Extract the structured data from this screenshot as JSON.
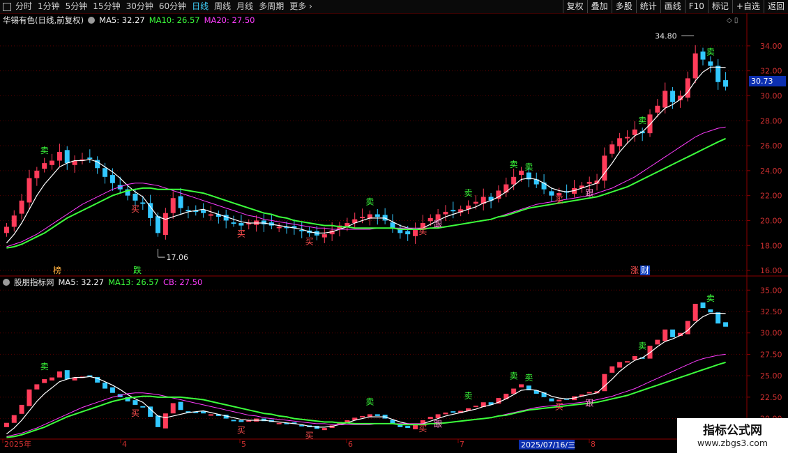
{
  "toolbar": {
    "periods": [
      "分时",
      "1分钟",
      "5分钟",
      "15分钟",
      "30分钟",
      "60分钟",
      "日线",
      "周线",
      "月线",
      "多周期",
      "更多"
    ],
    "active_period": "日线",
    "right_buttons": [
      "复权",
      "叠加",
      "多股",
      "统计",
      "画线",
      "F10",
      "标记",
      "+自选",
      "返回"
    ]
  },
  "main_legend": {
    "title": "华锡有色(日线,前复权)",
    "ma5": "MA5: 32.27",
    "ma10": "MA10: 26.57",
    "ma20": "MA20: 27.50"
  },
  "sub_legend": {
    "title": "股朋指标网",
    "ma5": "MA5: 32.27",
    "ma13": "MA13: 26.57",
    "cb": "CB: 27.50"
  },
  "main_axis_ticks": [
    "34.00",
    "32.00",
    "30.00",
    "28.00",
    "26.00",
    "24.00",
    "22.00",
    "20.00",
    "18.00",
    "16.00"
  ],
  "sub_axis_ticks": [
    "35.00",
    "32.50",
    "30.00",
    "27.50",
    "25.00",
    "22.50",
    "20.00"
  ],
  "current_price": "30.73",
  "high_annotation": "34.80",
  "low_annotation": "17.06",
  "x_labels": [
    "2025年",
    "4",
    "5",
    "6",
    "7",
    "8"
  ],
  "cursor_date": "2025/07/16/三",
  "badges": {
    "bang": "榜",
    "die": "跌",
    "zhang": "涨",
    "cai": "财"
  },
  "signals": {
    "sell": "卖",
    "buy": "买",
    "follow": "跟"
  },
  "watermark": {
    "line1": "指标公式网",
    "line2": "www.zbgs3.com"
  },
  "colors": {
    "up": "#ff3c5a",
    "down": "#32c8ff",
    "ma_white": "#ffffff",
    "ma_green": "#3cff3c",
    "ma_magenta": "#ff3cff",
    "grid": "#5a0000"
  },
  "chart_data": {
    "type": "candlestick",
    "closes": [
      19.5,
      20.4,
      21.6,
      23.4,
      24.0,
      24.6,
      24.8,
      25.5,
      24.6,
      24.8,
      24.9,
      25.0,
      24.2,
      23.5,
      23.0,
      22.5,
      22.0,
      21.6,
      21.4,
      20.2,
      19.0,
      20.6,
      21.8,
      21.0,
      20.8,
      20.7,
      20.6,
      20.5,
      20.3,
      20.0,
      19.8,
      19.6,
      19.8,
      20.0,
      19.7,
      19.6,
      19.5,
      19.4,
      19.4,
      19.2,
      19.0,
      18.8,
      18.9,
      19.2,
      19.6,
      19.8,
      20.1,
      20.3,
      20.5,
      20.3,
      20.0,
      19.4,
      19.0,
      18.9,
      19.3,
      19.8,
      20.2,
      20.5,
      20.7,
      20.8,
      20.9,
      21.2,
      21.5,
      21.9,
      21.6,
      22.4,
      22.9,
      23.5,
      24.0,
      23.3,
      22.9,
      22.5,
      22.0,
      22.2,
      22.3,
      22.6,
      22.8,
      23.1,
      23.2,
      25.2,
      26.1,
      26.6,
      26.7,
      27.3,
      27.0,
      28.5,
      29.2,
      30.4,
      29.5,
      30.0,
      31.4,
      33.4,
      32.9,
      32.4,
      31.1,
      30.73
    ],
    "ma_short": [
      18.2,
      18.9,
      19.8,
      20.9,
      22.0,
      22.9,
      23.6,
      24.3,
      24.6,
      24.8,
      24.8,
      24.9,
      24.7,
      24.3,
      23.9,
      23.4,
      22.8,
      22.3,
      21.9,
      21.1,
      20.3,
      20.1,
      20.3,
      20.5,
      20.7,
      20.8,
      20.9,
      20.7,
      20.5,
      20.3,
      20.1,
      19.9,
      19.8,
      19.8,
      19.8,
      19.7,
      19.6,
      19.5,
      19.4,
      19.3,
      19.1,
      19.0,
      19.0,
      19.1,
      19.3,
      19.5,
      19.8,
      20.0,
      20.2,
      20.2,
      20.2,
      19.9,
      19.6,
      19.4,
      19.3,
      19.4,
      19.7,
      20.0,
      20.3,
      20.5,
      20.7,
      20.9,
      21.1,
      21.4,
      21.6,
      21.9,
      22.3,
      22.8,
      23.3,
      23.4,
      23.3,
      23.0,
      22.6,
      22.4,
      22.3,
      22.4,
      22.6,
      22.8,
      23.0,
      23.8,
      24.6,
      25.5,
      26.2,
      26.8,
      27.1,
      27.7,
      28.4,
      29.0,
      29.3,
      29.7,
      30.3,
      31.2,
      31.9,
      32.3,
      32.3,
      32.27
    ],
    "ma_long": [
      17.8,
      17.9,
      18.1,
      18.4,
      18.7,
      19.0,
      19.4,
      19.8,
      20.2,
      20.5,
      20.8,
      21.1,
      21.4,
      21.7,
      22.0,
      22.2,
      22.4,
      22.5,
      22.6,
      22.6,
      22.5,
      22.5,
      22.5,
      22.5,
      22.4,
      22.3,
      22.2,
      22.0,
      21.8,
      21.6,
      21.4,
      21.2,
      21.0,
      20.8,
      20.6,
      20.5,
      20.3,
      20.2,
      20.0,
      19.9,
      19.8,
      19.7,
      19.6,
      19.6,
      19.5,
      19.5,
      19.4,
      19.4,
      19.4,
      19.4,
      19.4,
      19.4,
      19.3,
      19.3,
      19.3,
      19.3,
      19.4,
      19.4,
      19.5,
      19.6,
      19.7,
      19.8,
      19.9,
      20.0,
      20.1,
      20.3,
      20.4,
      20.6,
      20.8,
      21.0,
      21.1,
      21.2,
      21.3,
      21.4,
      21.5,
      21.6,
      21.7,
      21.8,
      21.9,
      22.1,
      22.3,
      22.5,
      22.7,
      23.0,
      23.3,
      23.6,
      23.9,
      24.2,
      24.5,
      24.8,
      25.1,
      25.4,
      25.7,
      26.0,
      26.3,
      26.57
    ],
    "ma_mid": [
      17.9,
      18.1,
      18.3,
      18.6,
      18.9,
      19.3,
      19.7,
      20.1,
      20.5,
      20.9,
      21.3,
      21.6,
      21.9,
      22.2,
      22.5,
      22.7,
      22.9,
      23.0,
      23.0,
      22.9,
      22.8,
      22.6,
      22.4,
      22.2,
      22.0,
      21.8,
      21.6,
      21.4,
      21.2,
      21.0,
      20.8,
      20.6,
      20.4,
      20.3,
      20.1,
      20.0,
      19.9,
      19.8,
      19.7,
      19.6,
      19.5,
      19.4,
      19.4,
      19.3,
      19.3,
      19.3,
      19.3,
      19.3,
      19.3,
      19.4,
      19.4,
      19.4,
      19.4,
      19.4,
      19.4,
      19.4,
      19.4,
      19.5,
      19.5,
      19.6,
      19.7,
      19.8,
      19.9,
      20.0,
      20.1,
      20.3,
      20.5,
      20.7,
      20.9,
      21.1,
      21.3,
      21.4,
      21.5,
      21.6,
      21.7,
      21.8,
      21.9,
      22.0,
      22.2,
      22.4,
      22.6,
      22.9,
      23.2,
      23.5,
      23.9,
      24.3,
      24.7,
      25.1,
      25.5,
      25.9,
      26.3,
      26.7,
      27.0,
      27.2,
      27.4,
      27.5
    ],
    "main_ylim": [
      15.5,
      35.5
    ],
    "sub_ylim": [
      18.5,
      36.0
    ],
    "series": [
      {
        "name": "MA5"
      },
      {
        "name": "MA10"
      },
      {
        "name": "MA20"
      }
    ]
  }
}
